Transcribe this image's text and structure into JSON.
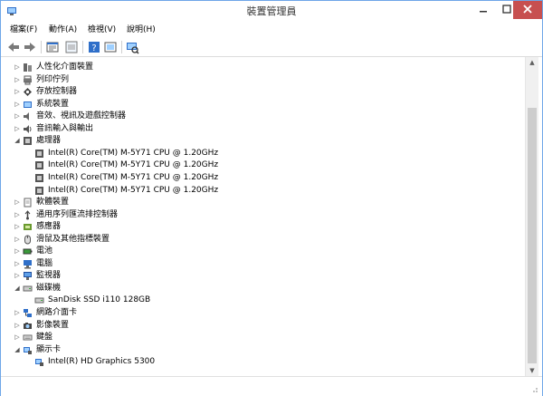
{
  "window": {
    "title": "裝置管理員"
  },
  "menu": [
    "檔案(F)",
    "動作(A)",
    "檢視(V)",
    "說明(H)"
  ],
  "toolbar": {
    "icons": [
      "back-arrow-icon",
      "forward-arrow-icon",
      "properties-icon",
      "show-hidden-icon",
      "help-icon",
      "update-driver-icon",
      "scan-hardware-icon"
    ]
  },
  "tree": [
    {
      "label": "人性化介面裝置",
      "level": 0,
      "expanded": false,
      "icon": "hid-icon"
    },
    {
      "label": "列印佇列",
      "level": 0,
      "expanded": false,
      "icon": "printer-icon"
    },
    {
      "label": "存放控制器",
      "level": 0,
      "expanded": false,
      "icon": "storage-controller-icon"
    },
    {
      "label": "系統裝置",
      "level": 0,
      "expanded": false,
      "icon": "system-device-icon"
    },
    {
      "label": "音效、視訊及遊戲控制器",
      "level": 0,
      "expanded": false,
      "icon": "sound-icon"
    },
    {
      "label": "音訊輸入與輸出",
      "level": 0,
      "expanded": false,
      "icon": "audio-io-icon"
    },
    {
      "label": "處理器",
      "level": 0,
      "expanded": true,
      "icon": "processor-icon"
    },
    {
      "label": "Intel(R) Core(TM) M-5Y71 CPU @ 1.20GHz",
      "level": 1,
      "icon": "processor-icon"
    },
    {
      "label": "Intel(R) Core(TM) M-5Y71 CPU @ 1.20GHz",
      "level": 1,
      "icon": "processor-icon"
    },
    {
      "label": "Intel(R) Core(TM) M-5Y71 CPU @ 1.20GHz",
      "level": 1,
      "icon": "processor-icon"
    },
    {
      "label": "Intel(R) Core(TM) M-5Y71 CPU @ 1.20GHz",
      "level": 1,
      "icon": "processor-icon"
    },
    {
      "label": "軟體裝置",
      "level": 0,
      "expanded": false,
      "icon": "software-device-icon"
    },
    {
      "label": "通用序列匯流排控制器",
      "level": 0,
      "expanded": false,
      "icon": "usb-icon"
    },
    {
      "label": "感應器",
      "level": 0,
      "expanded": false,
      "icon": "sensor-icon"
    },
    {
      "label": "滑鼠及其他指標裝置",
      "level": 0,
      "expanded": false,
      "icon": "mouse-icon"
    },
    {
      "label": "電池",
      "level": 0,
      "expanded": false,
      "icon": "battery-icon"
    },
    {
      "label": "電腦",
      "level": 0,
      "expanded": false,
      "icon": "computer-icon"
    },
    {
      "label": "監視器",
      "level": 0,
      "expanded": false,
      "icon": "monitor-icon"
    },
    {
      "label": "磁碟機",
      "level": 0,
      "expanded": true,
      "icon": "disk-drive-icon"
    },
    {
      "label": "SanDisk SSD i110 128GB",
      "level": 1,
      "icon": "disk-drive-icon"
    },
    {
      "label": "網路介面卡",
      "level": 0,
      "expanded": false,
      "icon": "network-adapter-icon"
    },
    {
      "label": "影像裝置",
      "level": 0,
      "expanded": false,
      "icon": "imaging-device-icon"
    },
    {
      "label": "鍵盤",
      "level": 0,
      "expanded": false,
      "icon": "keyboard-icon"
    },
    {
      "label": "顯示卡",
      "level": 0,
      "expanded": true,
      "icon": "display-adapter-icon"
    },
    {
      "label": "Intel(R) HD Graphics 5300",
      "level": 1,
      "icon": "display-adapter-icon"
    }
  ],
  "colors": {
    "close_button": "#c75050",
    "window_border": "#6ea6e8",
    "icon_blue": "#2f6fc9"
  }
}
